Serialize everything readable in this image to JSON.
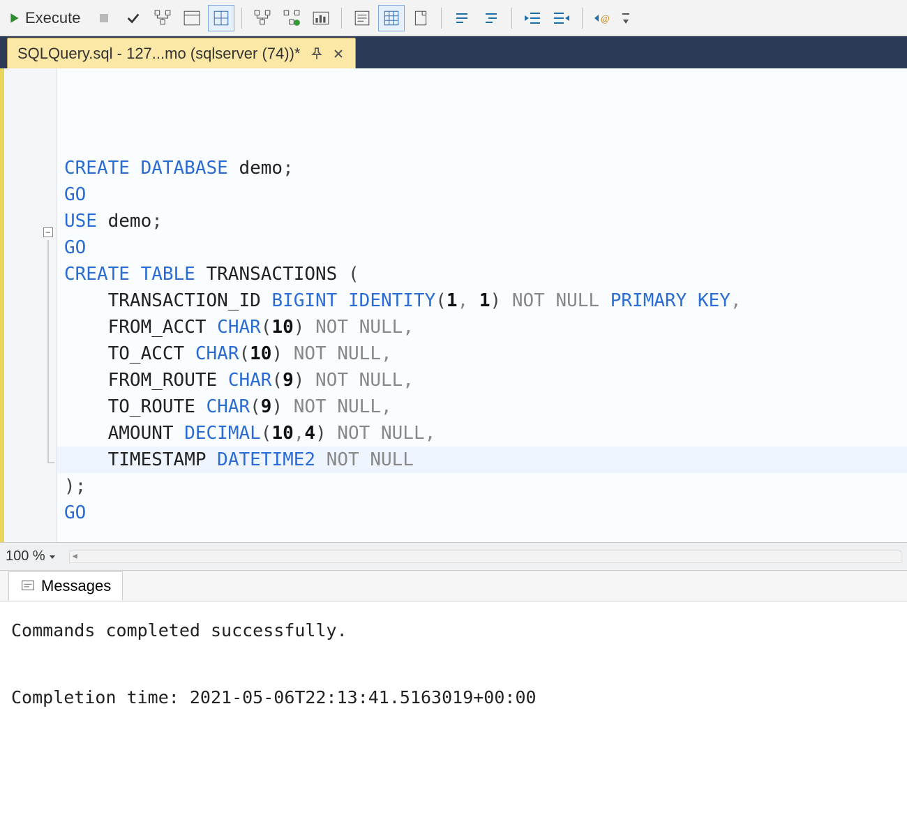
{
  "toolbar": {
    "execute_label": "Execute"
  },
  "tab": {
    "title": "SQLQuery.sql - 127...mo (sqlserver (74))*"
  },
  "zoom": {
    "percent": "100 %"
  },
  "code": {
    "lines": [
      {
        "segs": [
          [
            "kw",
            "CREATE DATABASE"
          ],
          [
            "ident",
            " demo"
          ],
          [
            "semi",
            ";"
          ]
        ]
      },
      {
        "segs": [
          [
            "kw",
            "GO"
          ]
        ]
      },
      {
        "segs": [
          [
            "kw",
            "USE"
          ],
          [
            "ident",
            " demo"
          ],
          [
            "semi",
            ";"
          ]
        ]
      },
      {
        "segs": [
          [
            "kw",
            "GO"
          ]
        ]
      },
      {
        "segs": [
          [
            "",
            ""
          ]
        ]
      },
      {
        "segs": [
          [
            "kw",
            "CREATE TABLE"
          ],
          [
            "ident",
            " TRANSACTIONS "
          ],
          [
            "paren",
            "("
          ]
        ]
      },
      {
        "segs": [
          [
            "",
            "    "
          ],
          [
            "ident",
            "TRANSACTION_ID "
          ],
          [
            "ty",
            "BIGINT IDENTITY"
          ],
          [
            "paren",
            "("
          ],
          [
            "num",
            "1"
          ],
          [
            "comma",
            ", "
          ],
          [
            "num",
            "1"
          ],
          [
            "paren",
            ")"
          ],
          [
            "gray",
            " NOT NULL "
          ],
          [
            "kw",
            "PRIMARY KEY"
          ],
          [
            "comma",
            ","
          ]
        ]
      },
      {
        "segs": [
          [
            "",
            "    "
          ],
          [
            "ident",
            "FROM_ACCT "
          ],
          [
            "ty",
            "CHAR"
          ],
          [
            "paren",
            "("
          ],
          [
            "num",
            "10"
          ],
          [
            "paren",
            ")"
          ],
          [
            "gray",
            " NOT NULL"
          ],
          [
            "comma",
            ","
          ]
        ]
      },
      {
        "segs": [
          [
            "",
            "    "
          ],
          [
            "ident",
            "TO_ACCT "
          ],
          [
            "ty",
            "CHAR"
          ],
          [
            "paren",
            "("
          ],
          [
            "num",
            "10"
          ],
          [
            "paren",
            ")"
          ],
          [
            "gray",
            " NOT NULL"
          ],
          [
            "comma",
            ","
          ]
        ]
      },
      {
        "segs": [
          [
            "",
            "    "
          ],
          [
            "ident",
            "FROM_ROUTE "
          ],
          [
            "ty",
            "CHAR"
          ],
          [
            "paren",
            "("
          ],
          [
            "num",
            "9"
          ],
          [
            "paren",
            ")"
          ],
          [
            "gray",
            " NOT NULL"
          ],
          [
            "comma",
            ","
          ]
        ]
      },
      {
        "segs": [
          [
            "",
            "    "
          ],
          [
            "ident",
            "TO_ROUTE "
          ],
          [
            "ty",
            "CHAR"
          ],
          [
            "paren",
            "("
          ],
          [
            "num",
            "9"
          ],
          [
            "paren",
            ")"
          ],
          [
            "gray",
            " NOT NULL"
          ],
          [
            "comma",
            ","
          ]
        ]
      },
      {
        "segs": [
          [
            "",
            "    "
          ],
          [
            "ident",
            "AMOUNT "
          ],
          [
            "ty",
            "DECIMAL"
          ],
          [
            "paren",
            "("
          ],
          [
            "num",
            "10"
          ],
          [
            "comma",
            ","
          ],
          [
            "num",
            "4"
          ],
          [
            "paren",
            ")"
          ],
          [
            "gray",
            " NOT NULL"
          ],
          [
            "comma",
            ","
          ]
        ]
      },
      {
        "segs": [
          [
            "",
            "    "
          ],
          [
            "ident",
            "TIMESTAMP "
          ],
          [
            "ty",
            "DATETIME2"
          ],
          [
            "gray",
            " NOT NULL"
          ]
        ]
      },
      {
        "segs": [
          [
            "paren",
            ")"
          ],
          [
            "semi",
            ";"
          ]
        ]
      },
      {
        "segs": [
          [
            "kw",
            "GO"
          ]
        ]
      }
    ]
  },
  "messages": {
    "tab_label": "Messages",
    "line1": "Commands completed successfully.",
    "line2": "",
    "line3": "Completion time: 2021-05-06T22:13:41.5163019+00:00"
  }
}
